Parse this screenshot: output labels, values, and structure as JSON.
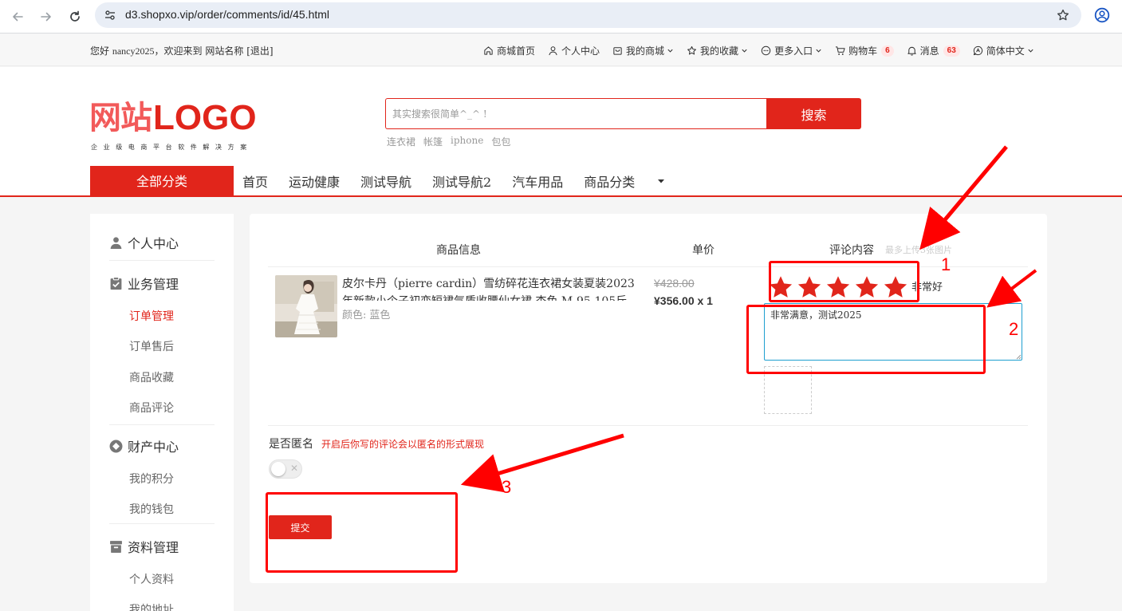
{
  "browser": {
    "url": "d3.shopxo.vip/order/comments/id/45.html",
    "icons": [
      "back-arrow-icon",
      "forward-arrow-icon",
      "reload-icon",
      "site-settings-icon",
      "bookmark-star-icon",
      "profile-icon"
    ]
  },
  "topbar": {
    "welcome_prefix": "您好",
    "username": "nancy2025",
    "welcome_suffix": "，欢迎来到",
    "site_name": "网站名称",
    "logout": "[退出]",
    "links": [
      {
        "label": "商城首页",
        "icon": "home-icon"
      },
      {
        "label": "个人中心",
        "icon": "user-icon"
      },
      {
        "label": "我的商城",
        "icon": "shop-icon",
        "dropdown": true
      },
      {
        "label": "我的收藏",
        "icon": "star-outline-icon",
        "dropdown": true
      },
      {
        "label": "更多入口",
        "icon": "more-circle-icon",
        "dropdown": true
      },
      {
        "label": "购物车",
        "icon": "cart-icon",
        "badge": "6"
      },
      {
        "label": "消息",
        "icon": "bell-icon",
        "badge": "63"
      },
      {
        "label": "简体中文",
        "icon": "language-icon",
        "dropdown": true
      }
    ]
  },
  "header": {
    "logo_cn": "网站",
    "logo_en": "LOGO",
    "logo_tagline": "企业级电商平台软件解决方案",
    "search_placeholder": "其实搜索很简单^_^ !",
    "search_button": "搜索",
    "hot_words": [
      "连衣裙",
      "帐篷",
      "iphone",
      "包包"
    ],
    "all_categories": "全部分类",
    "nav": [
      "首页",
      "运动健康",
      "测试导航",
      "测试导航2",
      "汽车用品",
      "商品分类"
    ]
  },
  "sidebar": {
    "groups": [
      {
        "title": "个人中心",
        "icon": "person-icon",
        "items": []
      },
      {
        "title": "业务管理",
        "icon": "clipboard-check-icon",
        "items": [
          "订单管理",
          "订单售后",
          "商品收藏",
          "商品评论"
        ]
      },
      {
        "title": "财产中心",
        "icon": "diamond-circle-icon",
        "items": [
          "我的积分",
          "我的钱包"
        ]
      },
      {
        "title": "资料管理",
        "icon": "archive-icon",
        "items": [
          "个人资料",
          "我的地址"
        ]
      }
    ],
    "active_item": "订单管理"
  },
  "order": {
    "columns": [
      "商品信息",
      "单价",
      "评论内容"
    ],
    "upload_hint": "最多上传3张图片",
    "product": {
      "title": "皮尔卡丹（pierre cardin）雪纺碎花连衣裙女装夏装2023年新款小个子初恋短裙气质收腰仙女裙 杏色 M-95-105斤",
      "spec_label": "颜色:",
      "spec_value": "蓝色",
      "original_price": "¥428.00",
      "price": "¥356.00 x 1"
    },
    "rating": {
      "stars": 5,
      "max": 5,
      "text": "非常好"
    },
    "comment_text": "非常满意，测试2025",
    "anonymous": {
      "label": "是否匿名",
      "hint": "开启后你写的评论会以匿名的形式展现",
      "enabled": false
    },
    "submit": "提交"
  },
  "annotations": {
    "labels": [
      "1",
      "2",
      "3"
    ],
    "color": "#ff0000"
  },
  "colors": {
    "brand_red": "#e1251b",
    "annotation_red": "#ff0000",
    "focus_blue": "#1e9fd0"
  }
}
